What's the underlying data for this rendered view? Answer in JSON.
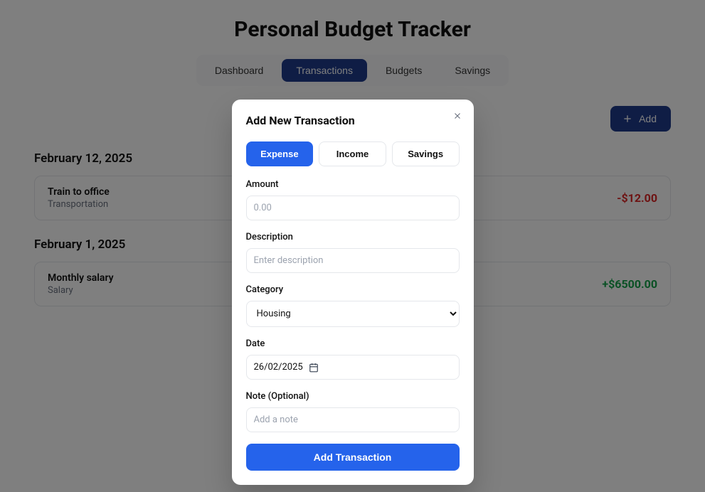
{
  "header": {
    "title": "Personal Budget Tracker"
  },
  "tabs": [
    {
      "label": "Dashboard",
      "active": false
    },
    {
      "label": "Transactions",
      "active": true
    },
    {
      "label": "Budgets",
      "active": false
    },
    {
      "label": "Savings",
      "active": false
    }
  ],
  "toolbar": {
    "add_label": "Add"
  },
  "transactions": [
    {
      "date_heading": "February 12, 2025",
      "items": [
        {
          "description": "Train to office",
          "category": "Transportation",
          "amount_display": "-$12.00",
          "kind": "expense"
        }
      ]
    },
    {
      "date_heading": "February 1, 2025",
      "items": [
        {
          "description": "Monthly salary",
          "category": "Salary",
          "amount_display": "+$6500.00",
          "kind": "income"
        }
      ]
    }
  ],
  "modal": {
    "title": "Add New Transaction",
    "type_options": [
      {
        "label": "Expense",
        "active": true
      },
      {
        "label": "Income",
        "active": false
      },
      {
        "label": "Savings",
        "active": false
      }
    ],
    "fields": {
      "amount": {
        "label": "Amount",
        "placeholder": "0.00",
        "value": ""
      },
      "description": {
        "label": "Description",
        "placeholder": "Enter description",
        "value": ""
      },
      "category": {
        "label": "Category",
        "selected": "Housing"
      },
      "date": {
        "label": "Date",
        "display": "26/02/2025"
      },
      "note": {
        "label": "Note (Optional)",
        "placeholder": "Add a note",
        "value": ""
      }
    },
    "submit_label": "Add Transaction"
  }
}
